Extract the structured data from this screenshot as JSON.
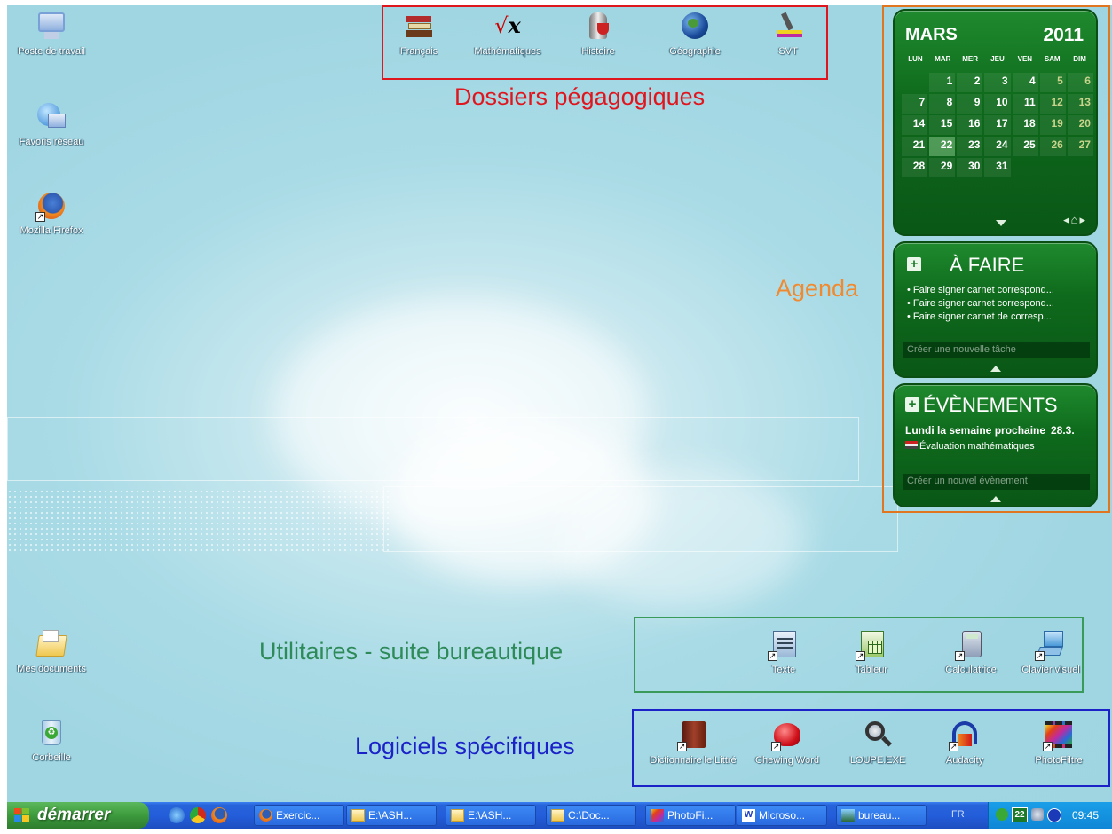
{
  "desktop_icons": [
    {
      "label": "Poste de travail",
      "icon": "computer-icon"
    },
    {
      "label": "Favoris réseau",
      "icon": "network-icon"
    },
    {
      "label": "Mozilla Firefox",
      "icon": "firefox-icon"
    },
    {
      "label": "Mes documents",
      "icon": "documents-folder-icon"
    },
    {
      "label": "Corbeille",
      "icon": "recycle-bin-icon"
    }
  ],
  "folders": {
    "caption": "Dossiers pégagogiques",
    "items": [
      {
        "label": "Français",
        "icon": "books-icon"
      },
      {
        "label": "Mathématiques",
        "icon": "sqrt-x-icon"
      },
      {
        "label": "Histoire",
        "icon": "knight-icon"
      },
      {
        "label": "Géographie",
        "icon": "globe-icon"
      },
      {
        "label": "SVT",
        "icon": "microscope-icon"
      }
    ]
  },
  "agenda_label": "Agenda",
  "calendar": {
    "month": "MARS",
    "year": "2011",
    "weekdays": [
      "LUN",
      "MAR",
      "MER",
      "JEU",
      "VEN",
      "SAM",
      "DIM"
    ],
    "first_weekday_index": 1,
    "days": [
      "1",
      "2",
      "3",
      "4",
      "5",
      "6",
      "7",
      "8",
      "9",
      "10",
      "11",
      "12",
      "13",
      "14",
      "15",
      "16",
      "17",
      "18",
      "19",
      "20",
      "21",
      "22",
      "23",
      "24",
      "25",
      "26",
      "27",
      "28",
      "29",
      "30",
      "31"
    ],
    "today": "22"
  },
  "todo": {
    "title": "À FAIRE",
    "tasks": [
      "Faire signer carnet correspond...",
      "Faire signer carnet correspond...",
      "Faire signer carnet de corresp..."
    ],
    "new_placeholder": "Créer une nouvelle tâche"
  },
  "events": {
    "title": "ÉVÈNEMENTS",
    "when": "Lundi la semaine prochaine",
    "date": "28.3.",
    "event": "Évaluation mathématiques",
    "new_placeholder": "Créer un nouvel évènement"
  },
  "utilities": {
    "caption": "Utilitaires - suite bureautique",
    "items": [
      {
        "label": "Texte",
        "icon": "text-document-icon"
      },
      {
        "label": "Tableur",
        "icon": "spreadsheet-icon"
      },
      {
        "label": "Calculatrice",
        "icon": "calculator-icon"
      },
      {
        "label": "Clavier visuel",
        "icon": "keyboard-icon"
      }
    ]
  },
  "software": {
    "caption": "Logiciels spécifiques",
    "items": [
      {
        "label": "Dictionnaire le Littré",
        "icon": "dictionary-book-icon"
      },
      {
        "label": "Chewing Word",
        "icon": "chewing-word-icon"
      },
      {
        "label": "LOUPE.EXE",
        "icon": "magnifier-icon"
      },
      {
        "label": "Audacity",
        "icon": "audacity-icon"
      },
      {
        "label": "PhotoFiltre",
        "icon": "photofiltre-icon"
      }
    ]
  },
  "taskbar": {
    "start_label": "démarrer",
    "buttons": [
      {
        "label": "Exercic...",
        "icon": "firefox-icon"
      },
      {
        "label": "E:\\ASH...",
        "icon": "folder-icon"
      },
      {
        "label": "E:\\ASH...",
        "icon": "folder-icon"
      },
      {
        "label": "C:\\Doc...",
        "icon": "folder-icon"
      },
      {
        "label": "PhotoFi...",
        "icon": "photofiltre-icon"
      },
      {
        "label": "Microso...",
        "icon": "word-icon"
      },
      {
        "label": "bureau...",
        "icon": "image-icon"
      }
    ],
    "language": "FR",
    "tray_date": "22",
    "clock": "09:45"
  },
  "colors": {
    "folders_border": "#e0161f",
    "agenda_border": "#e0761f",
    "utilities_border": "#3a9a5a",
    "software_border": "#1a22c8",
    "folders_text": "#e0161f",
    "agenda_text": "#f08a30",
    "utilities_text": "#2e8a58",
    "software_text": "#1a22c8"
  }
}
